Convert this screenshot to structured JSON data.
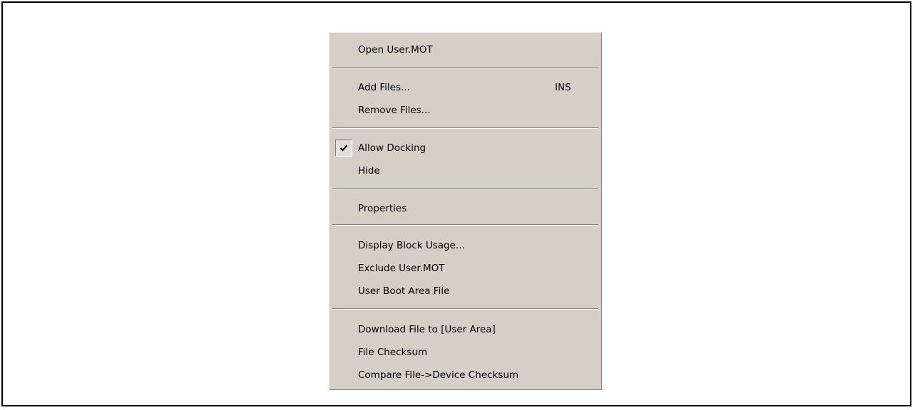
{
  "context_menu": {
    "items": [
      {
        "label": "Open User.MOT"
      },
      {
        "label": "Add Files...",
        "shortcut": "INS"
      },
      {
        "label": "Remove Files..."
      },
      {
        "label": "Allow Docking",
        "checked": true,
        "icon": "checkmark-icon"
      },
      {
        "label": "Hide"
      },
      {
        "label": "Properties"
      },
      {
        "label": "Display Block Usage..."
      },
      {
        "label": "Exclude User.MOT"
      },
      {
        "label": "User Boot Area File"
      },
      {
        "label": "Download File to [User Area]"
      },
      {
        "label": "File Checksum"
      },
      {
        "label": "Compare File->Device Checksum"
      }
    ]
  },
  "colors": {
    "menu_background": "#d4d0c8",
    "separator_dark": "#808080",
    "separator_light": "#ffffff",
    "frame_border": "#000000",
    "text": "#000000"
  }
}
